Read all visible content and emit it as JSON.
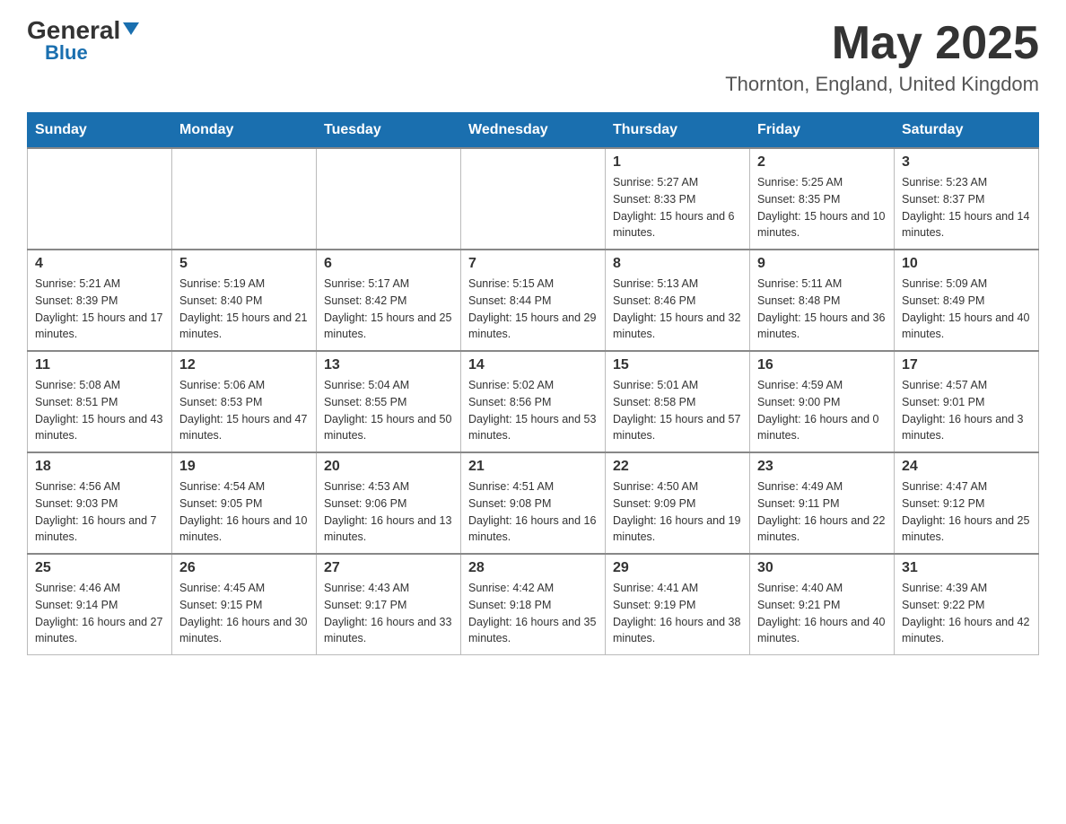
{
  "header": {
    "logo": {
      "general": "General",
      "blue": "Blue"
    },
    "month": "May 2025",
    "location": "Thornton, England, United Kingdom"
  },
  "weekdays": [
    "Sunday",
    "Monday",
    "Tuesday",
    "Wednesday",
    "Thursday",
    "Friday",
    "Saturday"
  ],
  "weeks": [
    [
      {
        "day": "",
        "sunrise": "",
        "sunset": "",
        "daylight": ""
      },
      {
        "day": "",
        "sunrise": "",
        "sunset": "",
        "daylight": ""
      },
      {
        "day": "",
        "sunrise": "",
        "sunset": "",
        "daylight": ""
      },
      {
        "day": "",
        "sunrise": "",
        "sunset": "",
        "daylight": ""
      },
      {
        "day": "1",
        "sunrise": "Sunrise: 5:27 AM",
        "sunset": "Sunset: 8:33 PM",
        "daylight": "Daylight: 15 hours and 6 minutes."
      },
      {
        "day": "2",
        "sunrise": "Sunrise: 5:25 AM",
        "sunset": "Sunset: 8:35 PM",
        "daylight": "Daylight: 15 hours and 10 minutes."
      },
      {
        "day": "3",
        "sunrise": "Sunrise: 5:23 AM",
        "sunset": "Sunset: 8:37 PM",
        "daylight": "Daylight: 15 hours and 14 minutes."
      }
    ],
    [
      {
        "day": "4",
        "sunrise": "Sunrise: 5:21 AM",
        "sunset": "Sunset: 8:39 PM",
        "daylight": "Daylight: 15 hours and 17 minutes."
      },
      {
        "day": "5",
        "sunrise": "Sunrise: 5:19 AM",
        "sunset": "Sunset: 8:40 PM",
        "daylight": "Daylight: 15 hours and 21 minutes."
      },
      {
        "day": "6",
        "sunrise": "Sunrise: 5:17 AM",
        "sunset": "Sunset: 8:42 PM",
        "daylight": "Daylight: 15 hours and 25 minutes."
      },
      {
        "day": "7",
        "sunrise": "Sunrise: 5:15 AM",
        "sunset": "Sunset: 8:44 PM",
        "daylight": "Daylight: 15 hours and 29 minutes."
      },
      {
        "day": "8",
        "sunrise": "Sunrise: 5:13 AM",
        "sunset": "Sunset: 8:46 PM",
        "daylight": "Daylight: 15 hours and 32 minutes."
      },
      {
        "day": "9",
        "sunrise": "Sunrise: 5:11 AM",
        "sunset": "Sunset: 8:48 PM",
        "daylight": "Daylight: 15 hours and 36 minutes."
      },
      {
        "day": "10",
        "sunrise": "Sunrise: 5:09 AM",
        "sunset": "Sunset: 8:49 PM",
        "daylight": "Daylight: 15 hours and 40 minutes."
      }
    ],
    [
      {
        "day": "11",
        "sunrise": "Sunrise: 5:08 AM",
        "sunset": "Sunset: 8:51 PM",
        "daylight": "Daylight: 15 hours and 43 minutes."
      },
      {
        "day": "12",
        "sunrise": "Sunrise: 5:06 AM",
        "sunset": "Sunset: 8:53 PM",
        "daylight": "Daylight: 15 hours and 47 minutes."
      },
      {
        "day": "13",
        "sunrise": "Sunrise: 5:04 AM",
        "sunset": "Sunset: 8:55 PM",
        "daylight": "Daylight: 15 hours and 50 minutes."
      },
      {
        "day": "14",
        "sunrise": "Sunrise: 5:02 AM",
        "sunset": "Sunset: 8:56 PM",
        "daylight": "Daylight: 15 hours and 53 minutes."
      },
      {
        "day": "15",
        "sunrise": "Sunrise: 5:01 AM",
        "sunset": "Sunset: 8:58 PM",
        "daylight": "Daylight: 15 hours and 57 minutes."
      },
      {
        "day": "16",
        "sunrise": "Sunrise: 4:59 AM",
        "sunset": "Sunset: 9:00 PM",
        "daylight": "Daylight: 16 hours and 0 minutes."
      },
      {
        "day": "17",
        "sunrise": "Sunrise: 4:57 AM",
        "sunset": "Sunset: 9:01 PM",
        "daylight": "Daylight: 16 hours and 3 minutes."
      }
    ],
    [
      {
        "day": "18",
        "sunrise": "Sunrise: 4:56 AM",
        "sunset": "Sunset: 9:03 PM",
        "daylight": "Daylight: 16 hours and 7 minutes."
      },
      {
        "day": "19",
        "sunrise": "Sunrise: 4:54 AM",
        "sunset": "Sunset: 9:05 PM",
        "daylight": "Daylight: 16 hours and 10 minutes."
      },
      {
        "day": "20",
        "sunrise": "Sunrise: 4:53 AM",
        "sunset": "Sunset: 9:06 PM",
        "daylight": "Daylight: 16 hours and 13 minutes."
      },
      {
        "day": "21",
        "sunrise": "Sunrise: 4:51 AM",
        "sunset": "Sunset: 9:08 PM",
        "daylight": "Daylight: 16 hours and 16 minutes."
      },
      {
        "day": "22",
        "sunrise": "Sunrise: 4:50 AM",
        "sunset": "Sunset: 9:09 PM",
        "daylight": "Daylight: 16 hours and 19 minutes."
      },
      {
        "day": "23",
        "sunrise": "Sunrise: 4:49 AM",
        "sunset": "Sunset: 9:11 PM",
        "daylight": "Daylight: 16 hours and 22 minutes."
      },
      {
        "day": "24",
        "sunrise": "Sunrise: 4:47 AM",
        "sunset": "Sunset: 9:12 PM",
        "daylight": "Daylight: 16 hours and 25 minutes."
      }
    ],
    [
      {
        "day": "25",
        "sunrise": "Sunrise: 4:46 AM",
        "sunset": "Sunset: 9:14 PM",
        "daylight": "Daylight: 16 hours and 27 minutes."
      },
      {
        "day": "26",
        "sunrise": "Sunrise: 4:45 AM",
        "sunset": "Sunset: 9:15 PM",
        "daylight": "Daylight: 16 hours and 30 minutes."
      },
      {
        "day": "27",
        "sunrise": "Sunrise: 4:43 AM",
        "sunset": "Sunset: 9:17 PM",
        "daylight": "Daylight: 16 hours and 33 minutes."
      },
      {
        "day": "28",
        "sunrise": "Sunrise: 4:42 AM",
        "sunset": "Sunset: 9:18 PM",
        "daylight": "Daylight: 16 hours and 35 minutes."
      },
      {
        "day": "29",
        "sunrise": "Sunrise: 4:41 AM",
        "sunset": "Sunset: 9:19 PM",
        "daylight": "Daylight: 16 hours and 38 minutes."
      },
      {
        "day": "30",
        "sunrise": "Sunrise: 4:40 AM",
        "sunset": "Sunset: 9:21 PM",
        "daylight": "Daylight: 16 hours and 40 minutes."
      },
      {
        "day": "31",
        "sunrise": "Sunrise: 4:39 AM",
        "sunset": "Sunset: 9:22 PM",
        "daylight": "Daylight: 16 hours and 42 minutes."
      }
    ]
  ]
}
